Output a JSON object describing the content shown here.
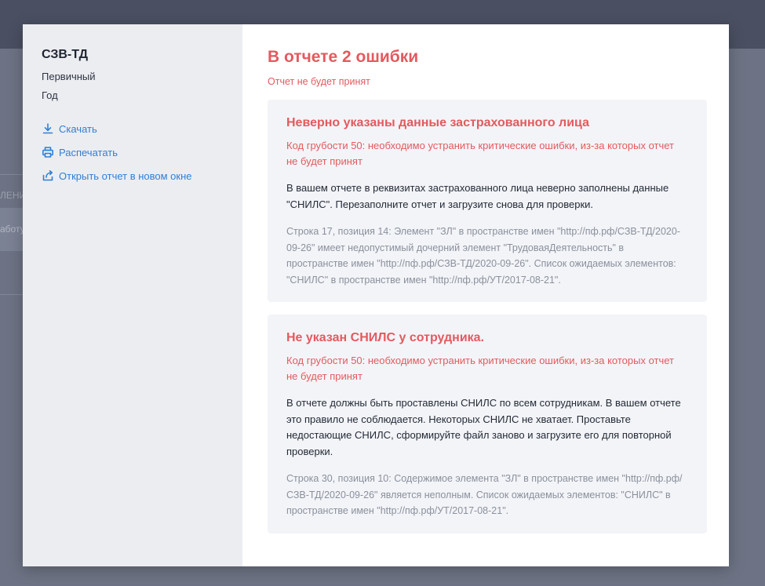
{
  "background": {
    "partial_labels": [
      "ЛЕНИ",
      "аботу"
    ]
  },
  "sidebar": {
    "title": "СЗВ-ТД",
    "meta": [
      "Первичный",
      "Год"
    ],
    "actions": [
      {
        "label": "Скачать",
        "icon": "download-icon"
      },
      {
        "label": "Распечатать",
        "icon": "printer-icon"
      },
      {
        "label": "Открыть отчет в новом окне",
        "icon": "external-link-icon"
      }
    ]
  },
  "main": {
    "title": "В отчете 2 ошибки",
    "subtitle": "Отчет не будет принят",
    "errors": [
      {
        "title": "Неверно указаны данные застрахованного лица",
        "severity": "Код грубости 50: необходимо устранить критические ошибки, из-за которых отчет не будет принят",
        "description": "В вашем отчете в реквизитах застрахованного лица неверно заполнены данные \"СНИЛС\". Перезаполните отчет и загрузите снова для проверки.",
        "technical": "Строка 17, позиция 14: Элемент \"ЗЛ\" в пространстве имен \"http://пф.рф/СЗВ-ТД/2020-09-26\" имеет недопустимый дочерний элемент \"ТрудоваяДеятельность\" в пространстве имен \"http://пф.рф/СЗВ-ТД/2020-09-26\". Список ожидаемых элементов: \"СНИЛС\" в пространстве имен \"http://пф.рф/УТ/2017-08-21\"."
      },
      {
        "title": "Не указан СНИЛС у сотрудника.",
        "severity": "Код грубости 50: необходимо устранить критические ошибки, из-за которых отчет не будет принят",
        "description": "В отчете должны быть проставлены СНИЛС по всем сотрудникам. В вашем отчете это правило не соблюдается. Некоторых СНИЛС не хватает. Проставьте недостающие СНИЛС, сформируйте файл заново и загрузите его для повторной проверки.",
        "technical": "Строка 30, позиция 10: Содержимое элемента \"ЗЛ\" в пространстве имен \"http://пф.рф/СЗВ-ТД/2020-09-26\" является неполным. Список ожидаемых элементов: \"СНИЛС\" в пространстве имен \"http://пф.рф/УТ/2017-08-21\"."
      }
    ]
  },
  "colors": {
    "error": "#e35a5f",
    "link": "#2f7fd6",
    "sidebar_bg": "#ecedf1",
    "card_bg": "#f3f4f8",
    "overlay": "#6d7384"
  }
}
